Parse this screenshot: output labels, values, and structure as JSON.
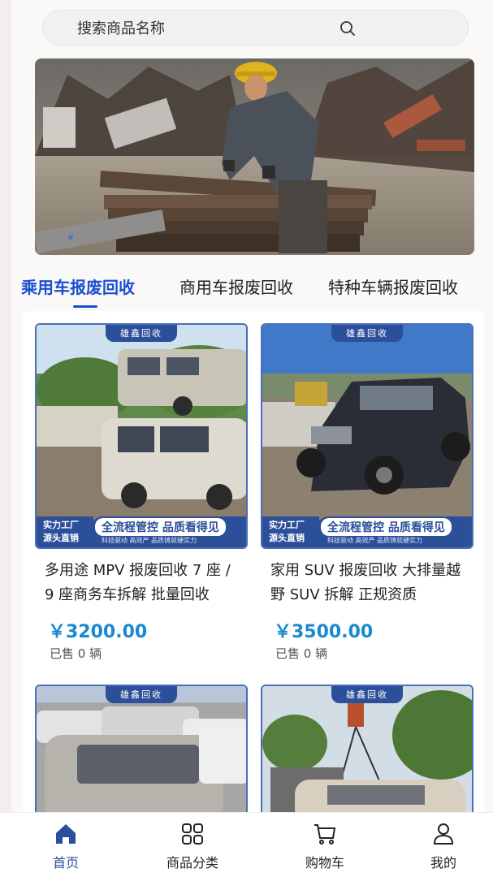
{
  "search": {
    "placeholder": "搜索商品名称"
  },
  "banner": {
    "slide_count": 1,
    "active_index": 0
  },
  "tabs": [
    {
      "label": "乘用车报废回收",
      "active": true
    },
    {
      "label": "商用车报废回收",
      "active": false
    },
    {
      "label": "特种车辆报废回收",
      "active": false
    }
  ],
  "card_overlay": {
    "brand": "雄鑫回收",
    "left_line1": "实力工厂",
    "left_line2": "源头直销",
    "slogan": "全流程管控 品质看得见",
    "sub": "科技驱动 高效产 品质铸就硬实力"
  },
  "products": [
    {
      "title": "多用途 MPV 报废回收 7 座 / 9 座商务车拆解 批量回收",
      "price": "￥3200.00",
      "sold": "已售 0 辆"
    },
    {
      "title": "家用 SUV 报废回收 大排量越野 SUV 拆解 正规资质",
      "price": "￥3500.00",
      "sold": "已售 0 辆"
    },
    {
      "title": "",
      "price": "",
      "sold": ""
    },
    {
      "title": "",
      "price": "",
      "sold": ""
    }
  ],
  "tabbar": [
    {
      "label": "首页",
      "icon": "home-icon",
      "active": true
    },
    {
      "label": "商品分类",
      "icon": "category-grid-icon",
      "active": false
    },
    {
      "label": "购物车",
      "icon": "cart-icon",
      "active": false
    },
    {
      "label": "我的",
      "icon": "user-icon",
      "active": false
    }
  ],
  "colors": {
    "accent": "#1a4fcf",
    "price": "#1a8ad0",
    "brand_blue": "#2c4f9a"
  }
}
